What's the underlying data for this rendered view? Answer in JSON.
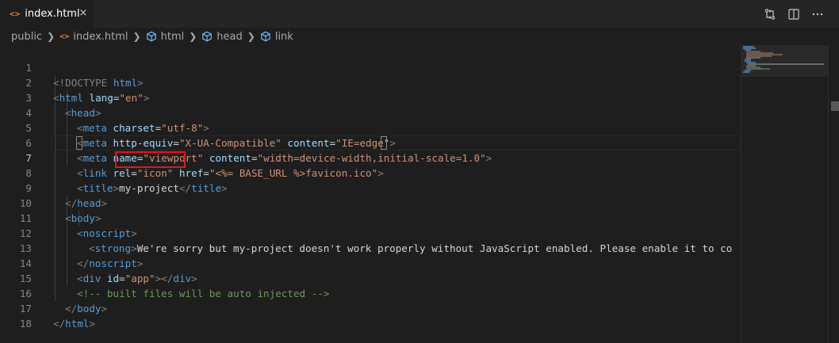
{
  "tab": {
    "icon": "<>",
    "label": "index.html",
    "close_icon": "×"
  },
  "breadcrumb": [
    {
      "label": "public",
      "icon": ""
    },
    {
      "label": "index.html",
      "icon": "html-file-icon"
    },
    {
      "label": "html",
      "icon": "cube-icon"
    },
    {
      "label": "head",
      "icon": "cube-icon"
    },
    {
      "label": "link",
      "icon": ""
    }
  ],
  "line_numbers": [
    "1",
    "2",
    "3",
    "4",
    "5",
    "6",
    "7",
    "8",
    "9",
    "10",
    "11",
    "12",
    "13",
    "14",
    "15",
    "16",
    "17",
    "18"
  ],
  "code": {
    "l1": {
      "a": "<!DOCTYPE ",
      "b": "html",
      "c": ">"
    },
    "l2": {
      "p1": "<",
      "tag": "html",
      "attr": " lang",
      "eq": "=",
      "str": "\"en\"",
      "p2": ">"
    },
    "l3": {
      "p1": "<",
      "tag": "head",
      "p2": ">"
    },
    "l4": {
      "p1": "<",
      "tag": "meta",
      "attr": " charset",
      "eq": "=",
      "str": "\"utf-8\"",
      "p2": ">"
    },
    "l5": {
      "p1": "<",
      "tag": "meta",
      "attr1": " http-equiv",
      "eq1": "=",
      "str1": "\"X-UA-Compatible\"",
      "attr2": " content",
      "eq2": "=",
      "str2": "\"IE=edge\"",
      "p2": ">"
    },
    "l6": {
      "p1": "<",
      "tag": "meta",
      "attr1": " name",
      "eq1": "=",
      "str1": "\"viewport\"",
      "attr2": " content",
      "eq2": "=",
      "str2": "\"width=device-width,initial-scale=1.0\"",
      "p2": ">"
    },
    "l7": {
      "p1": "<",
      "tag": "link",
      "attr1": " rel",
      "eq1": "=",
      "str1": "\"icon\"",
      "attr2": " href",
      "eq2": "=",
      "str2a": "\"",
      "tpl": "<%= BASE_URL %>",
      "str2b": "favicon.ico\"",
      "p2": ">"
    },
    "l8": {
      "p1": "<",
      "tag": "title",
      "p2": ">",
      "txt": "my-project",
      "p3": "</",
      "tag2": "title",
      "p4": ">"
    },
    "l9": {
      "p1": "</",
      "tag": "head",
      "p2": ">"
    },
    "l10": {
      "p1": "<",
      "tag": "body",
      "p2": ">"
    },
    "l11": {
      "p1": "<",
      "tag": "noscript",
      "p2": ">"
    },
    "l12": {
      "p1": "<",
      "tag": "strong",
      "p2": ">",
      "txt": "We're sorry but my-project doesn't work properly without JavaScript enabled. Please enable it to co"
    },
    "l13": {
      "p1": "</",
      "tag": "noscript",
      "p2": ">"
    },
    "l14": {
      "p1": "<",
      "tag": "div",
      "attr": " id",
      "eq": "=",
      "str": "\"app\"",
      "p2": "></",
      "tag2": "div",
      "p3": ">"
    },
    "l15": {
      "cmt": "<!-- built files will be auto injected -->"
    },
    "l16": {
      "p1": "</",
      "tag": "body",
      "p2": ">"
    },
    "l17": {
      "p1": "</",
      "tag": "html",
      "p2": ">"
    }
  },
  "colors": {
    "tag": "#569cd6",
    "attr": "#9cdcfe",
    "string": "#ce9178",
    "comment": "#6a9955",
    "highlight": "#e81123"
  },
  "toolbar": {
    "icons": [
      "source-control-compare-icon",
      "split-editor-icon",
      "more-actions-icon"
    ]
  }
}
